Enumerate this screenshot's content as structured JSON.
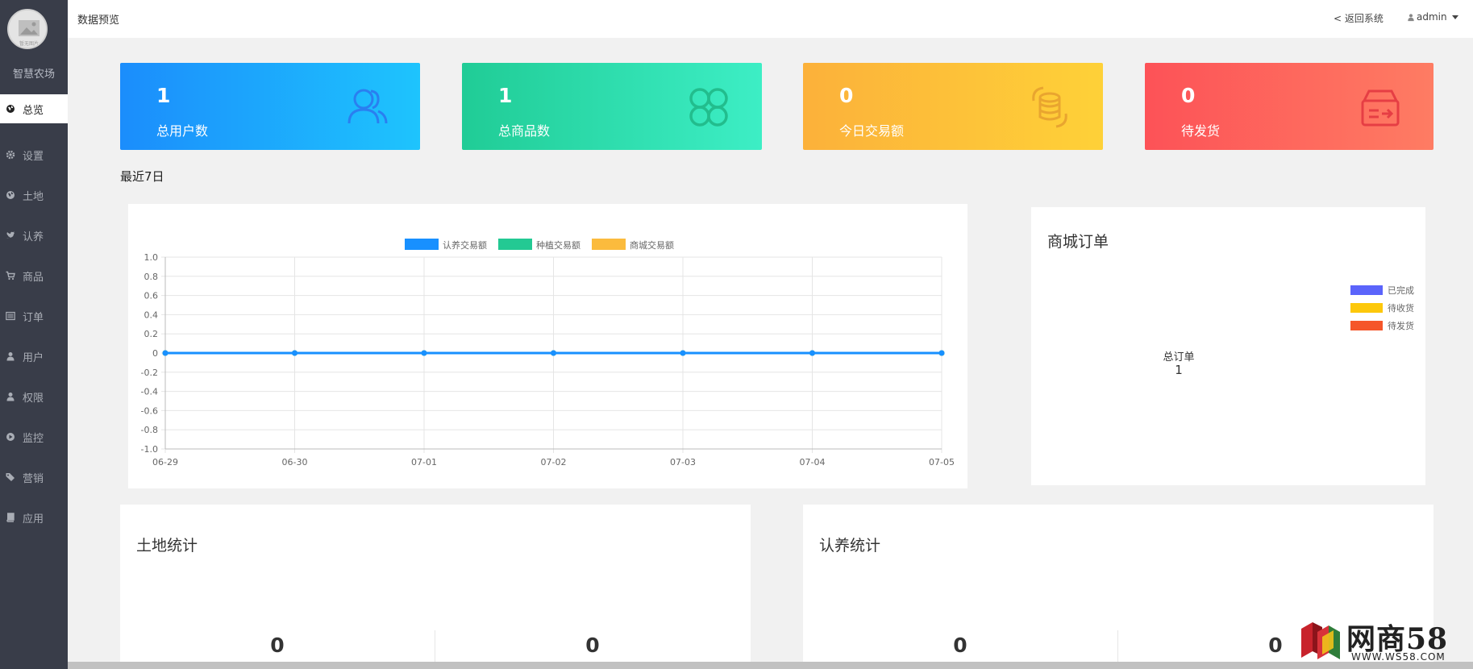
{
  "sidebar": {
    "avatar_caption": "暂无图片",
    "brand": "智慧农场",
    "items": [
      {
        "label": "总览",
        "icon": "globe-icon"
      },
      {
        "label": "设置",
        "icon": "gear-icon"
      },
      {
        "label": "土地",
        "icon": "globe-icon"
      },
      {
        "label": "认养",
        "icon": "twitter-icon"
      },
      {
        "label": "商品",
        "icon": "cart-icon"
      },
      {
        "label": "订单",
        "icon": "list-icon"
      },
      {
        "label": "用户",
        "icon": "user-icon"
      },
      {
        "label": "权限",
        "icon": "user-icon"
      },
      {
        "label": "监控",
        "icon": "play-circle-icon"
      },
      {
        "label": "营销",
        "icon": "tags-icon"
      },
      {
        "label": "应用",
        "icon": "book-icon"
      }
    ]
  },
  "header": {
    "title": "数据预览",
    "back_label": "< 返回系统",
    "user": "admin"
  },
  "stats": [
    {
      "value": "1",
      "label": "总用户数",
      "icon": "users-icon"
    },
    {
      "value": "1",
      "label": "总商品数",
      "icon": "clover-icon"
    },
    {
      "value": "0",
      "label": "今日交易额",
      "icon": "coins-icon"
    },
    {
      "value": "0",
      "label": "待发货",
      "icon": "shipping-box-icon"
    }
  ],
  "recent_label": "最近7日",
  "chart_data": {
    "type": "line",
    "categories": [
      "06-29",
      "06-30",
      "07-01",
      "07-02",
      "07-03",
      "07-04",
      "07-05"
    ],
    "series": [
      {
        "name": "认养交易额",
        "values": [
          0,
          0,
          0,
          0,
          0,
          0,
          0
        ],
        "color": "#1890ff"
      },
      {
        "name": "种植交易额",
        "values": [
          0,
          0,
          0,
          0,
          0,
          0,
          0
        ],
        "color": "#23c993"
      },
      {
        "name": "商城交易额",
        "values": [
          0,
          0,
          0,
          0,
          0,
          0,
          0
        ],
        "color": "#fbbb3d"
      }
    ],
    "ylim": [
      -1.0,
      1.0
    ],
    "yticks": [
      "1.0",
      "0.8",
      "0.6",
      "0.4",
      "0.2",
      "0",
      "-0.2",
      "-0.4",
      "-0.6",
      "-0.8",
      "-1.0"
    ],
    "legend": "top-center",
    "grid": true
  },
  "orders": {
    "title": "商城订单",
    "legend": [
      {
        "name": "已完成",
        "color": "#5b64fb"
      },
      {
        "name": "待收货",
        "color": "#fdc80b"
      },
      {
        "name": "待发货",
        "color": "#f5562a"
      }
    ],
    "center_label": "总订单",
    "center_value": "1"
  },
  "land": {
    "title": "土地统计",
    "values": [
      "0",
      "0"
    ]
  },
  "adoption": {
    "title": "认养统计",
    "values": [
      "0",
      "0"
    ]
  },
  "watermark": {
    "text": "网商58",
    "url": "WWW.WS58.COM"
  }
}
